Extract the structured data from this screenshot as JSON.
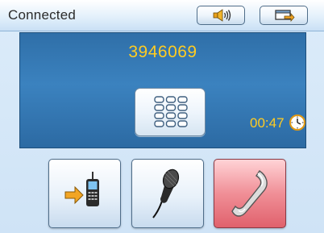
{
  "status": {
    "label": "Connected"
  },
  "top_buttons": [
    {
      "name": "volume",
      "icon": "speaker-icon"
    },
    {
      "name": "minimize",
      "icon": "minimize-window-icon"
    }
  ],
  "call": {
    "number": "3946069",
    "duration": "00:47",
    "timer_icon": "clock-icon",
    "keypad_icon": "keypad-icon"
  },
  "actions": [
    {
      "name": "transfer",
      "icon": "transfer-to-phone-icon"
    },
    {
      "name": "microphone",
      "icon": "microphone-icon"
    },
    {
      "name": "hang-up",
      "icon": "hang-up-handset-icon"
    }
  ],
  "colors": {
    "panel": "#3b82bf",
    "accent_text": "#ffcc22",
    "hangup": "#e0616c"
  }
}
